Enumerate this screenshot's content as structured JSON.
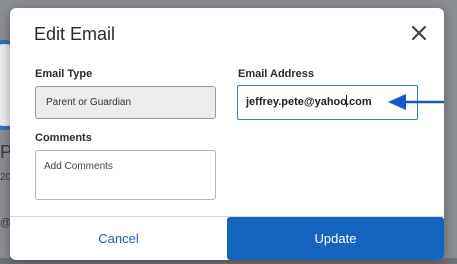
{
  "background": {
    "letter": "P",
    "small_text": "20",
    "at_text": "@"
  },
  "modal": {
    "title": "Edit Email",
    "close_icon": "close-icon",
    "email_type": {
      "label": "Email Type",
      "selected": "Parent or Guardian"
    },
    "email_address": {
      "label": "Email Address",
      "value_before_caret": "jeffrey.pete@yahoo",
      "value_after_caret": ".com"
    },
    "comments": {
      "label": "Comments",
      "placeholder": "Add Comments"
    },
    "cancel_label": "Cancel",
    "update_label": "Update",
    "colors": {
      "accent": "#1565c0",
      "arrow": "#1a56c8"
    }
  }
}
